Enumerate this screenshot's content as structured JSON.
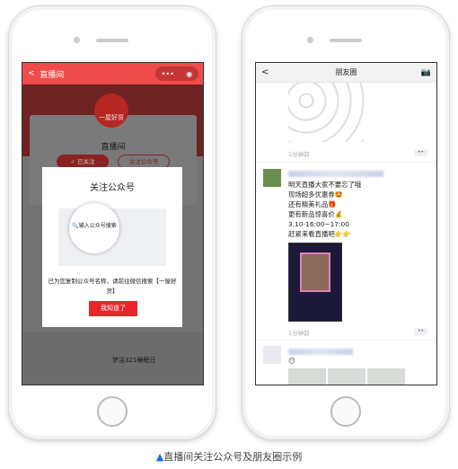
{
  "left_phone": {
    "header": {
      "title": "直播间",
      "more_icon": "more-dots-icon",
      "close_icon": "target-icon"
    },
    "profile": {
      "logo_text": "一屋好货",
      "name": "直播间",
      "followed_label": "已关注",
      "follow_account_label": "关注公众号"
    },
    "modal": {
      "title": "关注公众号",
      "search_placeholder": "输入公众号搜索",
      "message": "已为您复制公众号名称，请前往微信搜索【一屋好货】",
      "ok_label": "我知道了"
    },
    "list_item_title": "梦洁321睡眠日"
  },
  "right_phone": {
    "header": {
      "title": "朋友圈",
      "back_icon": "chevron-left-icon",
      "camera_icon": "camera-icon"
    },
    "posts": [
      {
        "time": "1分钟前",
        "more": "••"
      },
      {
        "time": "1分钟前",
        "more": "••",
        "lines": [
          "明天直播大家不要忘了哦",
          "现场超多优惠券🤩",
          "还有精美礼品🎁",
          "更有新品惊喜价💰",
          "3.10-16:00~17:00",
          "赶紧来看直播吧👉👉"
        ]
      },
      {
        "emoji": "😶"
      }
    ]
  },
  "caption": {
    "marker": "▲",
    "text": "直播间关注公众号及朋友圈示例"
  },
  "colors": {
    "brand_red": "#f04c4c",
    "button_red": "#e8262a",
    "caption_marker": "#1a6ee6"
  }
}
